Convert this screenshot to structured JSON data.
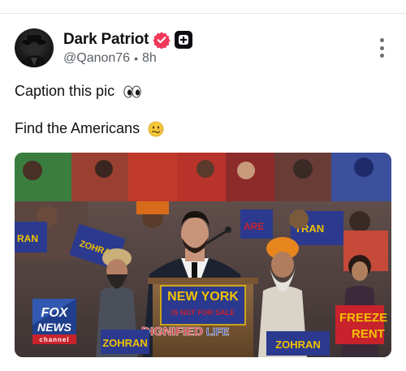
{
  "post": {
    "author_name": "Dark Patriot",
    "handle": "@Qanon76",
    "time": "8h",
    "separator": "•",
    "text_line1": "Caption this pic",
    "text_line2": "Find the Americans"
  },
  "media": {
    "network_logo": [
      "FOX",
      "NEWS",
      "channel"
    ],
    "podium_sign": [
      "NEW YORK",
      "IS NOT FOR SALE"
    ],
    "podium_banner": [
      "DIGNIFIED",
      "LIFE"
    ],
    "crowd_signs": [
      "ZOHRAN",
      "ZOHRAN",
      "ZOHRAN",
      "ZOHRAN",
      "FREEZE",
      "RENT",
      "TRAN",
      "RAN",
      "ARE"
    ]
  },
  "colors": {
    "verified_badge": "#f1385a",
    "text": "#0f1419",
    "muted": "#5b6066",
    "sign_blue": "#2b3a8f",
    "sign_yellow": "#f2c200",
    "sign_red": "#c8232c"
  },
  "icons": {
    "verified": "verified-badge-icon",
    "tag": "plus-badge-icon",
    "more": "more-vertical-icon",
    "eyes": "eyes-emoji-icon",
    "face": "wavy-smile-emoji-icon"
  }
}
